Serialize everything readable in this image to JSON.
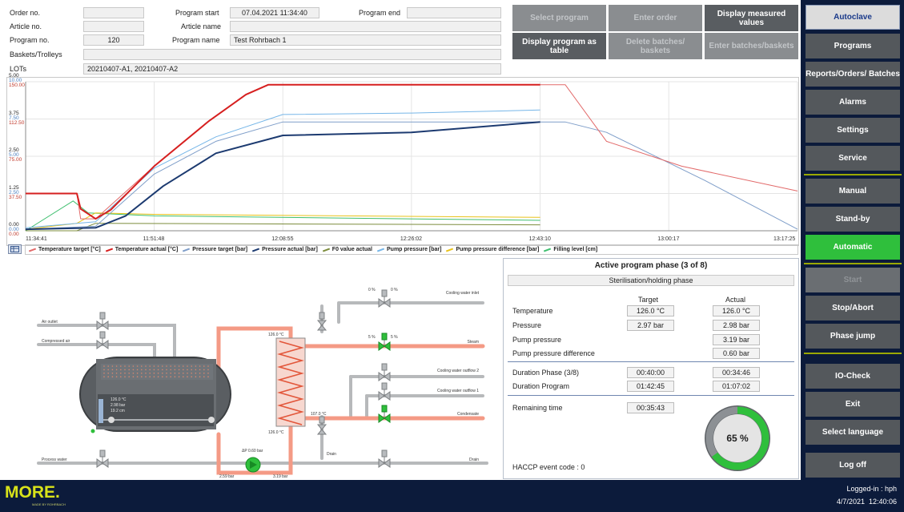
{
  "info": {
    "order_no_label": "Order no.",
    "article_no_label": "Article no.",
    "program_no_label": "Program no.",
    "program_no": "120",
    "baskets_label": "Baskets/Trolleys",
    "lots_label": "LOTs",
    "lots": "20210407-A1, 20210407-A2",
    "program_start_label": "Program start",
    "program_start": "07.04.2021 11:34:40",
    "program_end_label": "Program end",
    "article_name_label": "Article name",
    "program_name_label": "Program name",
    "program_name": "Test Rohrbach 1"
  },
  "toolbar": {
    "select_program": "Select program",
    "enter_order": "Enter order",
    "display_measured": "Display measured values",
    "display_table": "Display program as table",
    "delete_batches": "Delete batches/ baskets",
    "enter_batches": "Enter batches/baskets"
  },
  "sidebar": {
    "autoclave": "Autoclave",
    "programs": "Programs",
    "reports": "Reports/Orders/ Batches",
    "alarms": "Alarms",
    "settings": "Settings",
    "service": "Service",
    "manual": "Manual",
    "standby": "Stand-by",
    "automatic": "Automatic",
    "start": "Start",
    "stop": "Stop/Abort",
    "phase_jump": "Phase jump",
    "io_check": "IO-Check",
    "exit": "Exit",
    "language": "Select language",
    "logoff": "Log off"
  },
  "colors": {
    "temp_target": "#e26a6a",
    "temp_actual": "#d61f1f",
    "press_target": "#7f9ec9",
    "press_actual": "#1c3a70",
    "f0": "#7c8c3c",
    "pump": "#76b6e8",
    "pump_diff": "#e8c21a",
    "filling": "#3fbf6f",
    "green_button": "#2fbf3c",
    "sidebar_bg": "#0c1b3b"
  },
  "chart_data": {
    "type": "line",
    "x_ticks": [
      "11:34:41",
      "11:51:48",
      "12:08:55",
      "12:26:02",
      "12:43:10",
      "13:00:17",
      "13:17:25"
    ],
    "x_range": [
      "11:34:41",
      "13:17:25"
    ],
    "y_axes": [
      {
        "name": "F0/level",
        "ticks": [
          "0.00",
          "1.25",
          "2.50",
          "3.75",
          "5.00"
        ],
        "color": "#222222"
      },
      {
        "name": "pressure",
        "ticks": [
          "0.00",
          "2.50",
          "5.00",
          "7.50",
          "10.00"
        ],
        "color": "#4a7fbf"
      },
      {
        "name": "temperature",
        "ticks": [
          "0.00",
          "37.50",
          "75.00",
          "112.50",
          "150.00"
        ],
        "color": "#c0392b"
      }
    ],
    "legend": [
      "Temperature target [°C]",
      "Temperature actual [°C]",
      "Pressure target [bar]",
      "Pressure actual [bar]",
      "F0 value actual",
      "Pump pressure [bar]",
      "Pump pressure difference [bar]",
      "Filling level [cm]"
    ],
    "legend_placement": "bottom",
    "grid": true,
    "series": [
      {
        "name": "Temperature target [°C]",
        "axis": "temperature",
        "points": [
          [
            "11:34:41",
            37.5
          ],
          [
            "11:41:30",
            37.5
          ],
          [
            "11:42:00",
            12
          ],
          [
            "11:44:00",
            12
          ],
          [
            "11:51:48",
            65
          ],
          [
            "11:59:00",
            110
          ],
          [
            "12:04:00",
            137
          ],
          [
            "12:07:00",
            147
          ],
          [
            "12:20:00",
            147
          ],
          [
            "12:43:10",
            147
          ],
          [
            "12:46:30",
            147
          ],
          [
            "12:52:00",
            90
          ],
          [
            "13:02:00",
            65
          ],
          [
            "13:17:25",
            40
          ]
        ]
      },
      {
        "name": "Temperature actual [°C]",
        "axis": "temperature",
        "points": [
          [
            "11:34:41",
            37.5
          ],
          [
            "11:41:30",
            37.5
          ],
          [
            "11:42:00",
            22
          ],
          [
            "11:44:00",
            12
          ],
          [
            "11:46:00",
            21
          ],
          [
            "11:51:48",
            65
          ],
          [
            "11:59:00",
            110
          ],
          [
            "12:04:00",
            137
          ],
          [
            "12:07:00",
            147
          ],
          [
            "12:20:00",
            147
          ],
          [
            "12:43:10",
            147
          ]
        ]
      },
      {
        "name": "Pressure target [bar]",
        "axis": "pressure",
        "points": [
          [
            "11:34:41",
            0.1
          ],
          [
            "11:44:00",
            0.3
          ],
          [
            "11:51:48",
            3.8
          ],
          [
            "12:00:00",
            6.0
          ],
          [
            "12:08:55",
            7.3
          ],
          [
            "12:43:10",
            7.3
          ],
          [
            "12:46:30",
            7.3
          ],
          [
            "12:52:00",
            6.6
          ],
          [
            "13:05:00",
            3.4
          ],
          [
            "13:17:25",
            0.1
          ]
        ]
      },
      {
        "name": "Pressure actual [bar]",
        "axis": "pressure",
        "points": [
          [
            "11:34:41",
            0.1
          ],
          [
            "11:44:00",
            0.2
          ],
          [
            "11:48:00",
            1.0
          ],
          [
            "11:53:00",
            3.0
          ],
          [
            "12:00:00",
            5.2
          ],
          [
            "12:08:55",
            6.4
          ],
          [
            "12:26:02",
            6.6
          ],
          [
            "12:43:10",
            7.3
          ]
        ]
      },
      {
        "name": "F0 value actual",
        "axis": "F0/level",
        "points": [
          [
            "11:34:41",
            0.0
          ],
          [
            "11:41:30",
            0.0
          ],
          [
            "11:44:00",
            0.25
          ],
          [
            "12:43:10",
            0.2
          ]
        ]
      },
      {
        "name": "Pump pressure [bar]",
        "axis": "pressure",
        "points": [
          [
            "11:34:41",
            0.2
          ],
          [
            "11:44:00",
            0.6
          ],
          [
            "11:51:48",
            4.2
          ],
          [
            "12:00:00",
            6.3
          ],
          [
            "12:08:55",
            7.8
          ],
          [
            "12:26:02",
            7.9
          ],
          [
            "12:43:10",
            8.1
          ]
        ]
      },
      {
        "name": "Pump pressure difference [bar]",
        "axis": "pressure",
        "points": [
          [
            "11:34:41",
            0.1
          ],
          [
            "11:41:30",
            0.5
          ],
          [
            "11:44:00",
            1.2
          ],
          [
            "11:51:48",
            1.1
          ],
          [
            "12:43:10",
            0.9
          ]
        ]
      },
      {
        "name": "Filling level [cm]",
        "axis": "F0/level",
        "points": [
          [
            "11:34:41",
            0.0
          ],
          [
            "11:41:00",
            1.0
          ],
          [
            "11:43:00",
            0.6
          ],
          [
            "11:51:48",
            0.5
          ],
          [
            "12:43:10",
            0.35
          ]
        ]
      }
    ]
  },
  "phase": {
    "title": "Active program phase (3 of 8)",
    "name": "Sterilisation/holding phase",
    "target_header": "Target",
    "actual_header": "Actual",
    "temperature_label": "Temperature",
    "temperature_target": "126.0 °C",
    "temperature_actual": "126.0 °C",
    "pressure_label": "Pressure",
    "pressure_target": "2.97 bar",
    "pressure_actual": "2.98 bar",
    "pump_label": "Pump pressure",
    "pump_actual": "3.19 bar",
    "pump_diff_label": "Pump pressure difference",
    "pump_diff_actual": "0.60 bar",
    "duration_phase_label": "Duration Phase (3/8)",
    "duration_phase_target": "00:40:00",
    "duration_phase_actual": "00:34:46",
    "duration_program_label": "Duration Program",
    "duration_program_target": "01:42:45",
    "duration_program_actual": "01:07:02",
    "remaining_label": "Remaining time",
    "remaining_value": "00:35:43",
    "progress_percent": 65,
    "progress_label": "65 %",
    "haccp": "HACCP event code : 0"
  },
  "diagram": {
    "air_outlet": "Air outlet",
    "compressed_air": "Compressed air",
    "process_water": "Process water",
    "cooling_inlet": "Cooling water inlet",
    "steam": "Steam",
    "cooling_outflow2": "Cooling water outflow 2",
    "cooling_outflow1": "Cooling water outflow 1",
    "condensate": "Condensate",
    "drain": "Drain",
    "drain2": "Drain",
    "hx_top_temp": "126.0 °C",
    "hx_bottom_temp": "126.0 °C",
    "hx_right_temp": "107.0 °C",
    "vessel_temp": "126.0 °C",
    "vessel_press": "2.98 bar",
    "vessel_level": "19.2 cm",
    "pump_dp": "ΔP 0.60 bar",
    "pump_in": "2.59 bar",
    "pump_out": "3.19 bar",
    "v_cool_l": "0 %",
    "v_cool_r": "0 %",
    "v_steam_l": "5 %",
    "v_steam_r": "5 %"
  },
  "footer": {
    "logo": "MORE.",
    "logo_sub": "MADE BY ROHRBACH",
    "logged_in": "Logged-in : hph",
    "datetime": "4/7/2021  12:40:06"
  }
}
